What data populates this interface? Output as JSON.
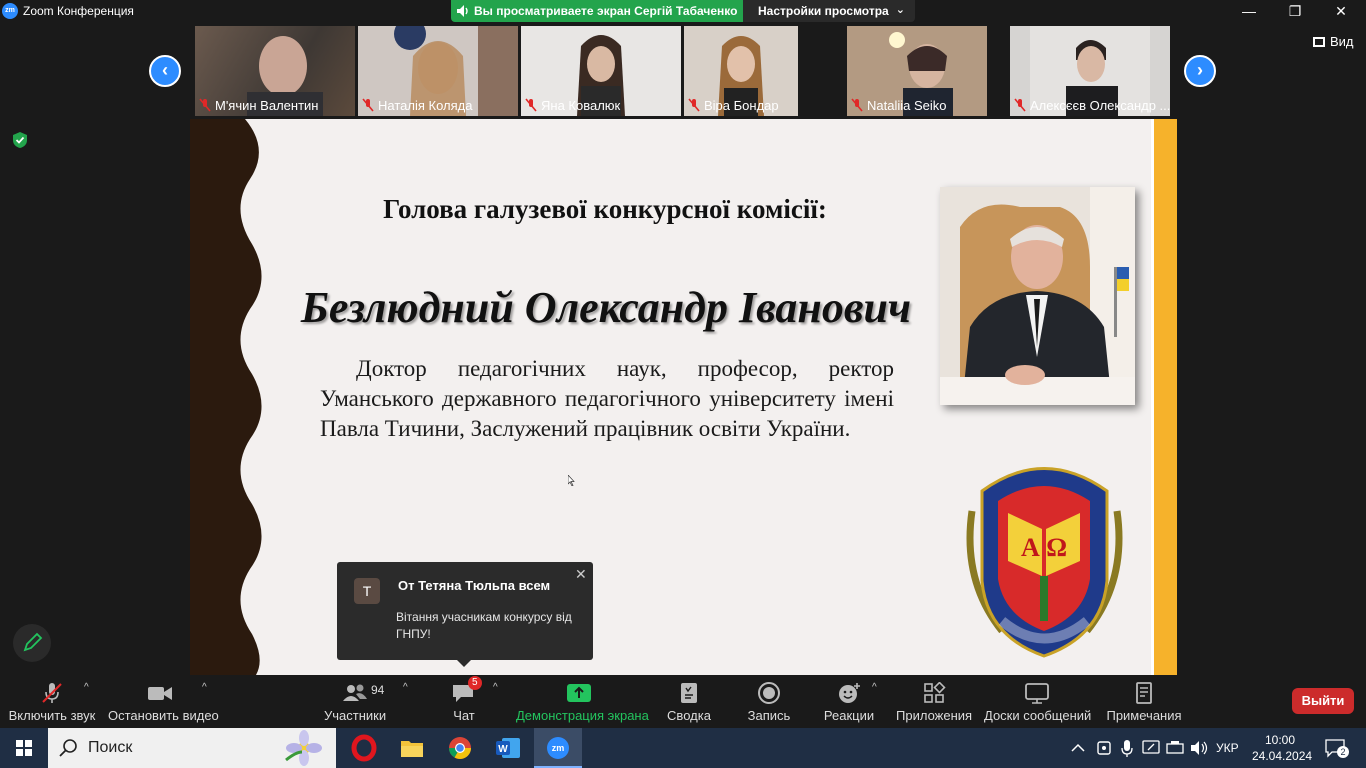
{
  "window": {
    "title": "Zoom Конференция",
    "logo_text": "zm",
    "minimize": "—",
    "maximize": "❐",
    "close": "✕"
  },
  "share_banner": {
    "text": "Вы просматриваете экран Сергій Табаченко",
    "view_settings_label": "Настройки просмотра",
    "color": "#23a44c"
  },
  "view_button": {
    "label": "Вид"
  },
  "participants_strip": [
    {
      "name": "М'ячин Валентин",
      "muted": true
    },
    {
      "name": "Наталія Коляда",
      "muted": true
    },
    {
      "name": "Яна Ковалюк",
      "muted": true
    },
    {
      "name": "Віра Бондар",
      "muted": true
    },
    {
      "name": "Nataliia Seiko",
      "muted": true
    },
    {
      "name": "Алексєєв Олександр ...",
      "muted": true
    }
  ],
  "slide": {
    "heading": "Голова галузевої конкурсної комісії:",
    "person_name": "Безлюдний Олександр Іванович",
    "description": "Доктор педагогічних наук, професор, ректор Уманського державного педагогічного університету імені Павла Тичини, Заслужений працівник освіти України.",
    "emblem_letters": "А Ω",
    "accent_color": "#f6b22b",
    "wave_color": "#2b1a0e"
  },
  "chat_toast": {
    "avatar_letter": "Т",
    "from": "От Тетяна Тюльпа всем",
    "message": "Вітання учасникам конкурсу від ГНПУ!",
    "close": "✕"
  },
  "toolbar": {
    "unmute": "Включить звук",
    "stop_video": "Остановить видео",
    "participants": "Участники",
    "participants_count": "94",
    "chat": "Чат",
    "chat_badge": "5",
    "share_screen": "Демонстрация экрана",
    "summary": "Сводка",
    "record": "Запись",
    "reactions": "Реакции",
    "apps": "Приложения",
    "whiteboards": "Доски сообщений",
    "notes": "Примечания",
    "leave": "Выйти",
    "caret": "^"
  },
  "taskbar": {
    "search_placeholder": "Поиск",
    "language": "УКР",
    "time": "10:00",
    "date": "24.04.2024",
    "notifications": "2"
  }
}
